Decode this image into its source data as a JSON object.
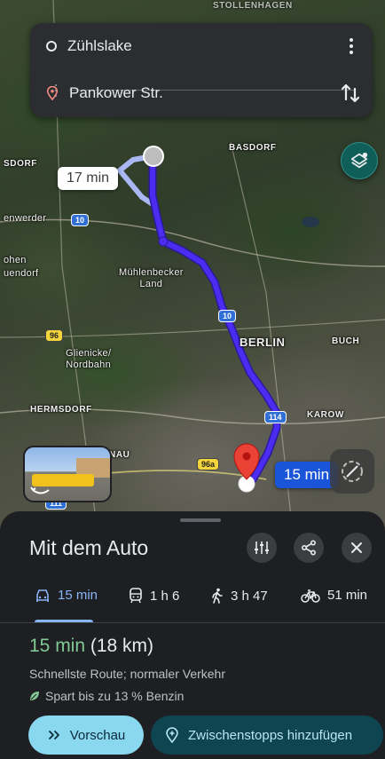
{
  "route_inputs": {
    "origin": "Zühlslake",
    "destination": "Pankower Str."
  },
  "map": {
    "place_labels": {
      "basdorf_right": "BASDORF",
      "basdorf_left": "SDORF",
      "wenwerder": "enwerder",
      "schoenfliess_a": "ohen",
      "schoenfliess_b": "uendorf",
      "muehlenbecker": "Mühlenbecker\nLand",
      "berlin": "BERLIN",
      "buch": "BUCH",
      "glienicke": "Glienicke/\nNordbahn",
      "hermsdorf": "HERMSDORF",
      "karow": "KAROW",
      "nau": "NAU",
      "top_cut": "STOLLENHAGEN"
    },
    "road_shields": {
      "a10_left": "10",
      "a10_mid": "10",
      "b96": "96",
      "b96a": "96a",
      "a114": "114",
      "a111": "111"
    },
    "alt_route_time": "17 min",
    "main_route_time": "15 min",
    "route_color": "#4b2cf0",
    "alt_route_color": "#a9b7f3"
  },
  "sheet": {
    "title": "Mit dem Auto",
    "modes": [
      {
        "icon": "car-icon",
        "label": "15 min",
        "active": true
      },
      {
        "icon": "transit-icon",
        "label": "1 h 6",
        "active": false
      },
      {
        "icon": "walk-icon",
        "label": "3 h 47",
        "active": false
      },
      {
        "icon": "bike-icon",
        "label": "51 min",
        "active": false
      }
    ],
    "summary_time": "15 min",
    "summary_distance": "(18 km)",
    "description": "Schnellste Route; normaler Verkehr",
    "saving": "Spart bis zu 13 % Benzin",
    "preview_button": "Vorschau",
    "stops_button": "Zwischenstopps hinzufügen",
    "accent": "#8ab4f8",
    "green": "#81c995"
  }
}
